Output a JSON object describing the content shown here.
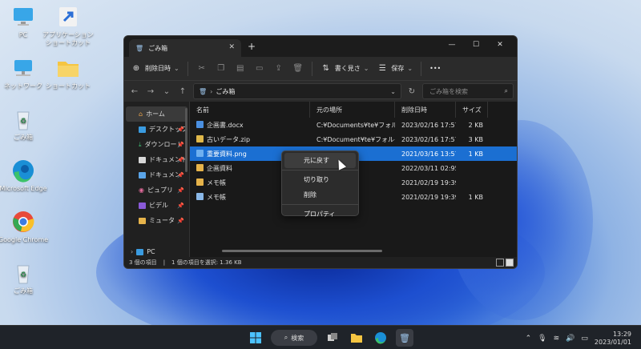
{
  "desktop": {
    "icons": [
      {
        "label": "PC"
      },
      {
        "label": "アプリケーションショートカット"
      },
      {
        "label": "ネットワーク"
      },
      {
        "label": "ショートカット"
      },
      {
        "label": "ごみ箱"
      },
      {
        "label": "Microsoft Edge"
      },
      {
        "label": "Google Chrome"
      },
      {
        "label": "ごみ箱"
      }
    ]
  },
  "window": {
    "tab_title": "ごみ箱",
    "new_tab": "+",
    "controls": {
      "min": "—",
      "max": "☐",
      "close": "✕"
    },
    "toolbar": {
      "delete_date": "削除日時",
      "write_out": "書く見さ",
      "save": "保存",
      "more": "•••"
    },
    "address": {
      "path": "ごみ箱",
      "search_placeholder": "ごみ箱を検索"
    },
    "sidebar": {
      "items": [
        {
          "label": "ホーム"
        },
        {
          "label": "デスクトップ"
        },
        {
          "label": "ダウンロード"
        },
        {
          "label": "ドキュメント"
        },
        {
          "label": "ドキュメン"
        },
        {
          "label": "ピュプリ"
        },
        {
          "label": "ビデル"
        },
        {
          "label": "ミュータ"
        }
      ],
      "pc": "PC"
    },
    "columns": {
      "name": "名前",
      "origin": "元の場所",
      "deleted": "削除日時",
      "size": "サイズ"
    },
    "files": [
      {
        "name": "企画書.docx",
        "origin": "C:¥Documents¥te¥フォルダ",
        "deleted": "2023/02/16 17:57",
        "size": "2 KB",
        "color": "#4a8fe0"
      },
      {
        "name": "古いデータ.zip",
        "origin": "C:¥Document¥te¥フォルダ",
        "deleted": "2023/02/16 17:57",
        "size": "3 KB",
        "color": "#e0b84a"
      },
      {
        "name": "重要資料.png",
        "origin": "",
        "deleted": "2021/03/16 13:57",
        "size": "1 KB",
        "color": "#6fb0f0"
      },
      {
        "name": "企画資料",
        "origin": "",
        "deleted": "2022/03/11 02:95",
        "size": "",
        "color": "#e6b34a"
      },
      {
        "name": "メモ帳",
        "origin": "ルダー",
        "deleted": "2021/02/19 19:39",
        "size": "",
        "color": "#e6b34a"
      },
      {
        "name": "メモ帳",
        "origin": "",
        "deleted": "2021/02/19 19:39",
        "size": "1 KB",
        "color": "#8ab8e8"
      }
    ],
    "status": {
      "count": "3 個の項目",
      "selected": "1 個の項目を選択: 1.36 KB"
    }
  },
  "context_menu": {
    "items": [
      "元に戻す",
      "切り取り",
      "削除",
      "プロパティ"
    ]
  },
  "taskbar": {
    "search_label": "検索",
    "clock_time": "13:29",
    "clock_date": "2023/01/01"
  }
}
